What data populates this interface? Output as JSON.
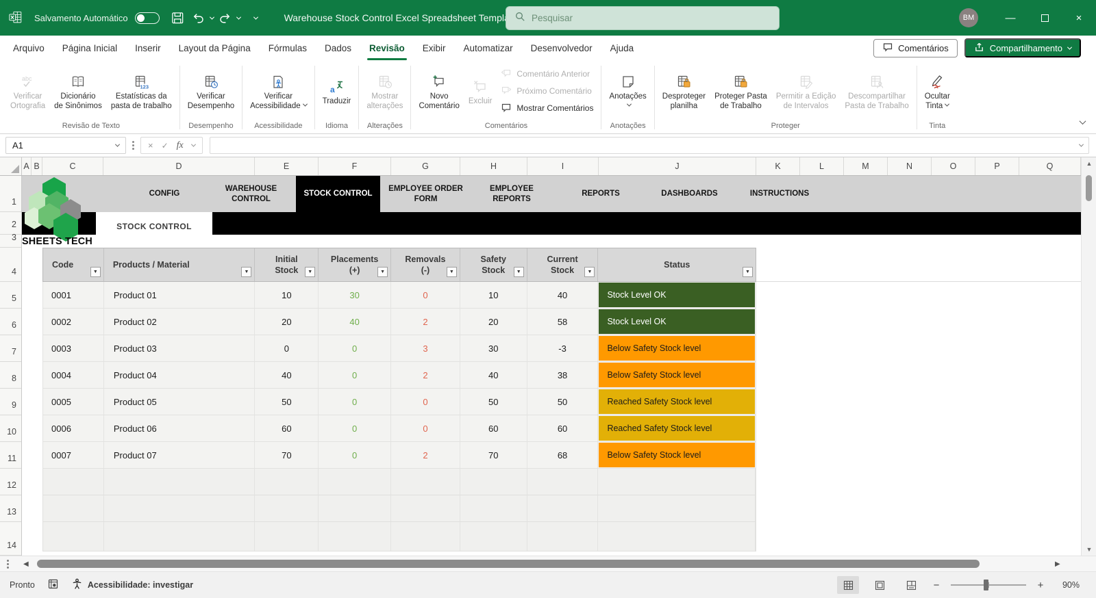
{
  "titlebar": {
    "autosave_label": "Salvamento Automático",
    "autosave_state": "off",
    "title": "Warehouse Stock Control Excel Spreadsheet Template",
    "search_placeholder": "Pesquisar",
    "avatar_initials": "BM"
  },
  "menubar": {
    "tabs": [
      "Arquivo",
      "Página Inicial",
      "Inserir",
      "Layout da Página",
      "Fórmulas",
      "Dados",
      "Revisão",
      "Exibir",
      "Automatizar",
      "Desenvolvedor",
      "Ajuda"
    ],
    "active": "Revisão",
    "comments_label": "Comentários",
    "share_label": "Compartilhamento"
  },
  "ribbon": {
    "groups": [
      {
        "label": "Revisão de Texto",
        "items": [
          {
            "lines": [
              "Verificar",
              "Ortografia"
            ],
            "icon": "spelling-icon",
            "disabled": true
          },
          {
            "lines": [
              "Dicionário",
              "de Sinônimos"
            ],
            "icon": "thesaurus-icon"
          },
          {
            "lines": [
              "Estatísticas da",
              "pasta de trabalho"
            ],
            "icon": "workbook-stats-icon"
          }
        ]
      },
      {
        "label": "Desempenho",
        "items": [
          {
            "lines": [
              "Verificar",
              "Desempenho"
            ],
            "icon": "check-performance-icon"
          }
        ]
      },
      {
        "label": "Acessibilidade",
        "items": [
          {
            "lines": [
              "Verificar",
              "Acessibilidade"
            ],
            "icon": "check-accessibility-icon",
            "caret": true
          }
        ]
      },
      {
        "label": "Idioma",
        "items": [
          {
            "lines": [
              "Traduzir"
            ],
            "icon": "translate-icon"
          }
        ]
      },
      {
        "label": "Alterações",
        "items": [
          {
            "lines": [
              "Mostrar",
              "alterações"
            ],
            "icon": "show-changes-icon",
            "disabled": true
          }
        ]
      },
      {
        "label": "Comentários",
        "items": [
          {
            "lines": [
              "Novo",
              "Comentário"
            ],
            "icon": "new-comment-icon"
          },
          {
            "lines": [
              "Excluir"
            ],
            "icon": "delete-comment-icon",
            "disabled": true
          },
          {
            "stack": [
              {
                "label": "Comentário Anterior",
                "icon": "previous-comment-icon",
                "disabled": true
              },
              {
                "label": "Próximo Comentário",
                "icon": "next-comment-icon",
                "disabled": true
              },
              {
                "label": "Mostrar Comentários",
                "icon": "show-comments-icon"
              }
            ]
          }
        ]
      },
      {
        "label": "Anotações",
        "items": [
          {
            "lines": [
              "Anotações"
            ],
            "icon": "notes-icon",
            "caret": true
          }
        ]
      },
      {
        "label": "Proteger",
        "items": [
          {
            "lines": [
              "Desproteger",
              "planilha"
            ],
            "icon": "unprotect-sheet-icon"
          },
          {
            "lines": [
              "Proteger Pasta",
              "de Trabalho"
            ],
            "icon": "protect-workbook-icon"
          },
          {
            "lines": [
              "Permitir a Edição",
              "de Intervalos"
            ],
            "icon": "allow-edit-ranges-icon",
            "disabled": true
          },
          {
            "lines": [
              "Descompartilhar",
              "Pasta de Trabalho"
            ],
            "icon": "unshare-workbook-icon",
            "disabled": true
          }
        ]
      },
      {
        "label": "Tinta",
        "items": [
          {
            "lines": [
              "Ocultar",
              "Tinta"
            ],
            "icon": "hide-ink-icon",
            "caret": true
          }
        ]
      }
    ]
  },
  "formula_bar": {
    "name_box": "A1",
    "formula": ""
  },
  "grid": {
    "columns": [
      "A",
      "B",
      "C",
      "D",
      "E",
      "F",
      "G",
      "H",
      "I",
      "J",
      "K",
      "L",
      "M",
      "N",
      "O",
      "P",
      "Q"
    ],
    "rows": [
      "1",
      "2",
      "3",
      "4",
      "5",
      "6",
      "7",
      "8",
      "9",
      "10",
      "11",
      "12",
      "13",
      "14"
    ]
  },
  "nav": {
    "items": [
      "CONFIG",
      "WAREHOUSE CONTROL",
      "STOCK CONTROL",
      "EMPLOYEE ORDER FORM",
      "EMPLOYEE REPORTS",
      "REPORTS",
      "DASHBOARDS",
      "INSTRUCTIONS"
    ],
    "active": "STOCK CONTROL",
    "sheet_tab": "STOCK CONTROL",
    "logo_text": "SHEETS TECH"
  },
  "table": {
    "headers": [
      {
        "lines": [
          "Code"
        ]
      },
      {
        "lines": [
          "Products / Material"
        ]
      },
      {
        "lines": [
          "Initial",
          "Stock"
        ]
      },
      {
        "lines": [
          "Placements",
          "(+)"
        ]
      },
      {
        "lines": [
          "Removals",
          "(-)"
        ]
      },
      {
        "lines": [
          "Safety",
          "Stock"
        ]
      },
      {
        "lines": [
          "Current",
          "Stock"
        ]
      },
      {
        "lines": [
          "Status"
        ]
      }
    ],
    "rows": [
      {
        "code": "0001",
        "product": "Product 01",
        "initial": "10",
        "placements": "30",
        "removals": "0",
        "safety": "10",
        "current": "40",
        "status": "Stock Level OK",
        "status_type": "ok"
      },
      {
        "code": "0002",
        "product": "Product 02",
        "initial": "20",
        "placements": "40",
        "removals": "2",
        "safety": "20",
        "current": "58",
        "status": "Stock Level OK",
        "status_type": "ok"
      },
      {
        "code": "0003",
        "product": "Product 03",
        "initial": "0",
        "placements": "0",
        "removals": "3",
        "safety": "30",
        "current": "-3",
        "status": "Below Safety Stock level",
        "status_type": "below"
      },
      {
        "code": "0004",
        "product": "Product 04",
        "initial": "40",
        "placements": "0",
        "removals": "2",
        "safety": "40",
        "current": "38",
        "status": "Below Safety Stock level",
        "status_type": "below"
      },
      {
        "code": "0005",
        "product": "Product 05",
        "initial": "50",
        "placements": "0",
        "removals": "0",
        "safety": "50",
        "current": "50",
        "status": "Reached Safety Stock level",
        "status_type": "reached"
      },
      {
        "code": "0006",
        "product": "Product 06",
        "initial": "60",
        "placements": "0",
        "removals": "0",
        "safety": "60",
        "current": "60",
        "status": "Reached Safety Stock level",
        "status_type": "reached"
      },
      {
        "code": "0007",
        "product": "Product 07",
        "initial": "70",
        "placements": "0",
        "removals": "2",
        "safety": "70",
        "current": "68",
        "status": "Below Safety Stock level",
        "status_type": "below"
      }
    ],
    "colors": {
      "status_ok": "#3A5F23",
      "status_below": "#FF9900",
      "status_reached": "#E2B007",
      "placements_text": "#6FAE4B",
      "removals_text": "#E0654F",
      "accent_green": "#107C41"
    }
  },
  "statusbar": {
    "mode": "Pronto",
    "accessibility": "Acessibilidade: investigar",
    "zoom_level": "90%"
  }
}
